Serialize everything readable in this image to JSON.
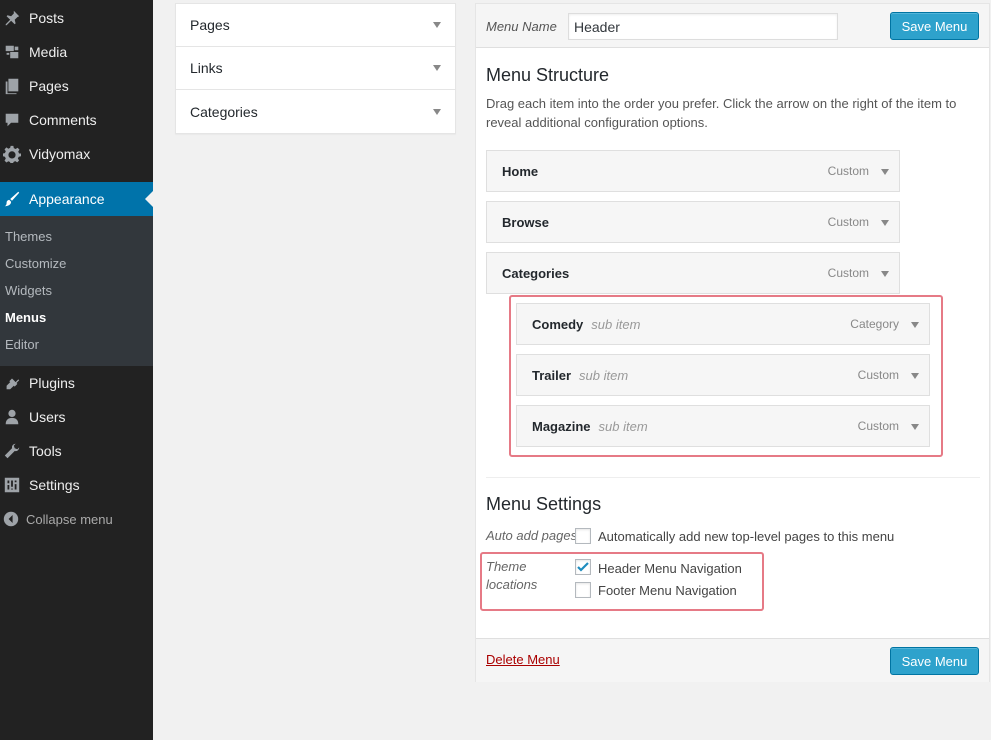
{
  "sidebar": {
    "items": [
      {
        "label": "Posts",
        "icon": "pin-icon"
      },
      {
        "label": "Media",
        "icon": "media-icon"
      },
      {
        "label": "Pages",
        "icon": "pages-icon"
      },
      {
        "label": "Comments",
        "icon": "comment-icon"
      },
      {
        "label": "Vidyomax",
        "icon": "gear-icon"
      },
      {
        "label": "Appearance",
        "icon": "paintbrush-icon",
        "active": true
      },
      {
        "label": "Plugins",
        "icon": "plugin-icon"
      },
      {
        "label": "Users",
        "icon": "user-icon"
      },
      {
        "label": "Tools",
        "icon": "wrench-icon"
      },
      {
        "label": "Settings",
        "icon": "settings-icon"
      }
    ],
    "submenu": [
      "Themes",
      "Customize",
      "Widgets",
      "Menus",
      "Editor"
    ],
    "current_submenu": "Menus",
    "collapse_label": "Collapse menu"
  },
  "accordion": {
    "sections": [
      "Pages",
      "Links",
      "Categories"
    ]
  },
  "editor": {
    "menu_name_label": "Menu Name",
    "menu_name_value": "Header",
    "save_label": "Save Menu",
    "structure_title": "Menu Structure",
    "structure_desc": "Drag each item into the order you prefer. Click the arrow on the right of the item to reveal additional configuration options.",
    "items": [
      {
        "title": "Home",
        "type": "Custom",
        "sub": ""
      },
      {
        "title": "Browse",
        "type": "Custom",
        "sub": ""
      },
      {
        "title": "Categories",
        "type": "Custom",
        "sub": ""
      },
      {
        "title": "Comedy",
        "type": "Category",
        "sub": "sub item"
      },
      {
        "title": "Trailer",
        "type": "Custom",
        "sub": "sub item"
      },
      {
        "title": "Magazine",
        "type": "Custom",
        "sub": "sub item"
      }
    ],
    "settings_title": "Menu Settings",
    "auto_add_label": "Auto add pages",
    "auto_add_text": "Automatically add new top-level pages to this menu",
    "auto_add_checked": false,
    "locations_label_1": "Theme",
    "locations_label_2": "locations",
    "locations": [
      {
        "label": "Header Menu Navigation",
        "checked": true
      },
      {
        "label": "Footer Menu Navigation",
        "checked": false
      }
    ],
    "delete_label": "Delete Menu"
  },
  "colors": {
    "sidebar_bg": "#222222",
    "active_bg": "#0073aa",
    "button_bg": "#2ea2cc",
    "highlight": "#e67a86",
    "delete_link": "#aa0000"
  }
}
